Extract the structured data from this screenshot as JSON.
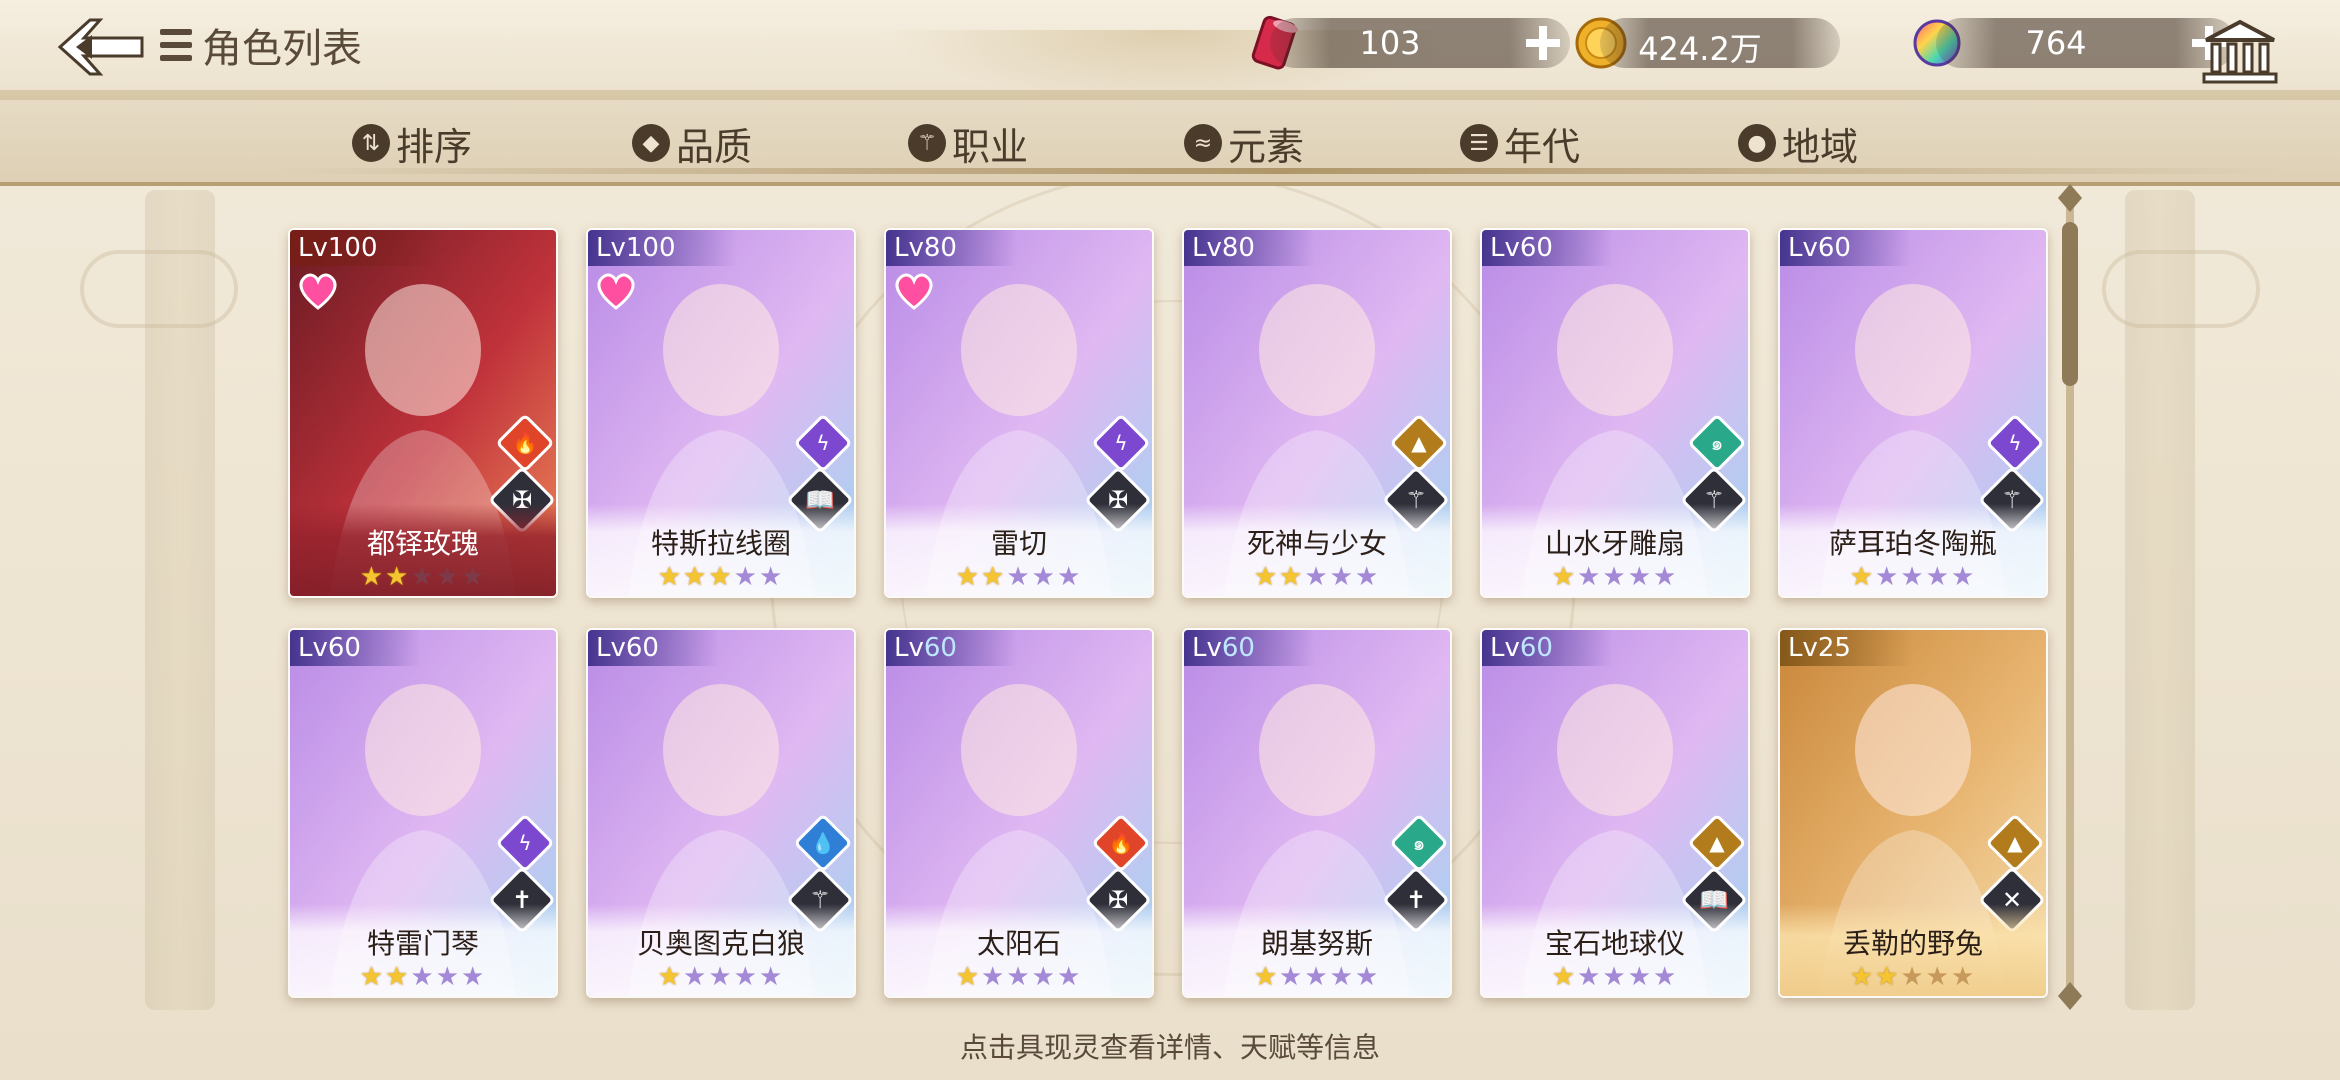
{
  "header": {
    "title": "角色列表",
    "resources": [
      {
        "name": "stamina-can",
        "value": "103",
        "color": "#d62a4a"
      },
      {
        "name": "gold-coin",
        "value": "424.2万",
        "color": "#f0b12a"
      },
      {
        "name": "rainbow-gem",
        "value": "764",
        "color": "#9b5cf0"
      }
    ]
  },
  "filters": [
    {
      "icon": "sort-icon",
      "label": "排序"
    },
    {
      "icon": "quality-icon",
      "label": "品质"
    },
    {
      "icon": "class-icon",
      "label": "职业"
    },
    {
      "icon": "element-icon",
      "label": "元素"
    },
    {
      "icon": "era-icon",
      "label": "年代"
    },
    {
      "icon": "region-icon",
      "label": "地域"
    }
  ],
  "cards": [
    {
      "lv_prefix": "Lv",
      "lv": "100",
      "name": "都铎玫瑰",
      "stars": 2,
      "max_stars": 5,
      "favorite": true,
      "element": "fire",
      "class": "sword",
      "theme": "red"
    },
    {
      "lv_prefix": "Lv",
      "lv": "100",
      "name": "特斯拉线圈",
      "stars": 3,
      "max_stars": 5,
      "favorite": true,
      "element": "thunder",
      "class": "book",
      "theme": "purple"
    },
    {
      "lv_prefix": "Lv",
      "lv": "80",
      "name": "雷切",
      "stars": 2,
      "max_stars": 5,
      "favorite": true,
      "element": "thunder",
      "class": "sword",
      "theme": "purple"
    },
    {
      "lv_prefix": "Lv",
      "lv": "80",
      "name": "死神与少女",
      "stars": 2,
      "max_stars": 5,
      "favorite": false,
      "element": "earth",
      "class": "lance",
      "theme": "purple"
    },
    {
      "lv_prefix": "Lv",
      "lv": "60",
      "name": "山水牙雕扇",
      "stars": 1,
      "max_stars": 5,
      "favorite": false,
      "element": "wind",
      "class": "lance",
      "theme": "purple"
    },
    {
      "lv_prefix": "Lv",
      "lv": "60",
      "name": "萨耳珀冬陶瓶",
      "stars": 1,
      "max_stars": 5,
      "favorite": false,
      "element": "thunder",
      "class": "lance",
      "theme": "purple"
    },
    {
      "lv_prefix": "Lv",
      "lv": "60",
      "name": "特雷门琴",
      "stars": 2,
      "max_stars": 5,
      "favorite": false,
      "element": "thunder",
      "class": "cross",
      "theme": "purple"
    },
    {
      "lv_prefix": "Lv",
      "lv": "60",
      "name": "贝奥图克白狼",
      "stars": 1,
      "max_stars": 5,
      "favorite": false,
      "element": "water",
      "class": "lance",
      "theme": "purple"
    },
    {
      "lv_prefix": "Lv",
      "lv": "60",
      "name": "太阳石",
      "stars": 1,
      "max_stars": 5,
      "favorite": false,
      "element": "fire",
      "class": "sword",
      "theme": "purple",
      "lv_blue": true
    },
    {
      "lv_prefix": "Lv",
      "lv": "60",
      "name": "朗基努斯",
      "stars": 1,
      "max_stars": 5,
      "favorite": false,
      "element": "wind",
      "class": "cross",
      "theme": "purple",
      "lv_blue": true
    },
    {
      "lv_prefix": "Lv",
      "lv": "60",
      "name": "宝石地球仪",
      "stars": 1,
      "max_stars": 5,
      "favorite": false,
      "element": "earth",
      "class": "book",
      "theme": "purple",
      "lv_blue": true
    },
    {
      "lv_prefix": "Lv",
      "lv": "25",
      "name": "丢勒的野兔",
      "stars": 2,
      "max_stars": 5,
      "favorite": false,
      "element": "earth",
      "class": "tools",
      "theme": "gold"
    }
  ],
  "hint": "点击具现灵查看详情、天赋等信息"
}
